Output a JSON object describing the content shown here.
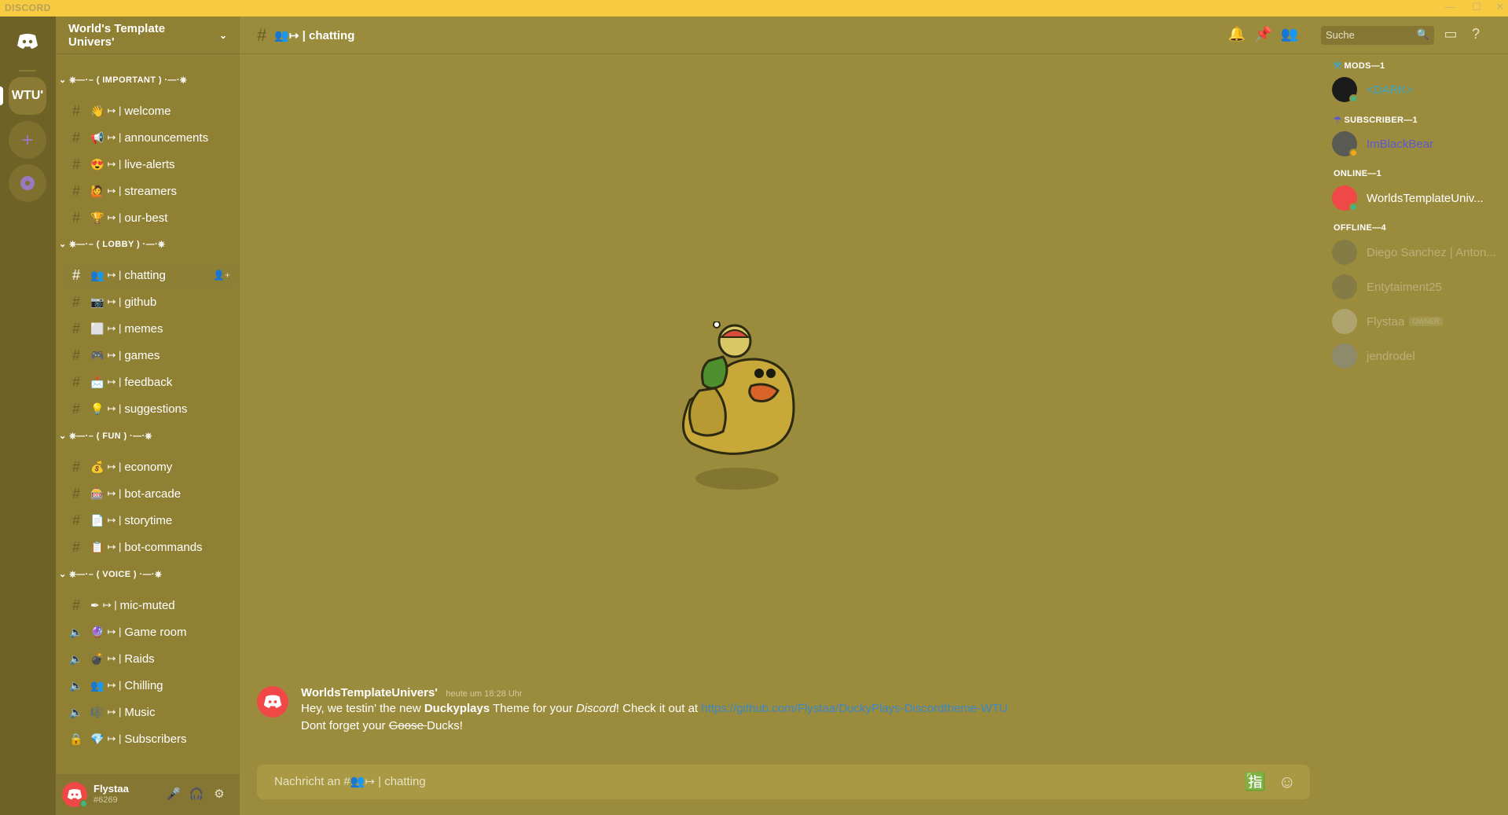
{
  "window": {
    "brand": "DISCORD",
    "minimize": "—",
    "maximize": "☐",
    "close": "✕"
  },
  "guilds": {
    "selected_acronym": "WTU'",
    "add_glyph": "+"
  },
  "server": {
    "name": "World's Template Univers'",
    "chevron": "⌄"
  },
  "categories": {
    "important": "⌄ ⎈—·– ( IMPORTANT ) ·—·⎈",
    "lobby": "⌄ ⎈—·– ( LOBBY ) ·—·⎈",
    "fun": "⌄ ⎈—·– ( FUN ) ·—·⎈",
    "voice": "⌄ ⎈—·– ( VOICE ) ·—·⎈"
  },
  "channels": [
    {
      "name": "welcome",
      "emoji": "👋",
      "type": "text"
    },
    {
      "name": "announcements",
      "emoji": "📢",
      "type": "text"
    },
    {
      "name": "live-alerts",
      "emoji": "😍",
      "type": "text"
    },
    {
      "name": "streamers",
      "emoji": "🙋",
      "type": "text"
    },
    {
      "name": "our-best",
      "emoji": "🏆",
      "type": "text"
    },
    {
      "name": "chatting",
      "emoji": "👥",
      "type": "text",
      "active": true
    },
    {
      "name": "github",
      "emoji": "📷",
      "type": "text"
    },
    {
      "name": "memes",
      "emoji": "⬜",
      "type": "text"
    },
    {
      "name": "games",
      "emoji": "🎮",
      "type": "text"
    },
    {
      "name": "feedback",
      "emoji": "📩",
      "type": "text"
    },
    {
      "name": "suggestions",
      "emoji": "💡",
      "type": "text"
    },
    {
      "name": "economy",
      "emoji": "💰",
      "type": "text"
    },
    {
      "name": "bot-arcade",
      "emoji": "🎰",
      "type": "text"
    },
    {
      "name": "storytime",
      "emoji": "📄",
      "type": "text"
    },
    {
      "name": "bot-commands",
      "emoji": "📋",
      "type": "text"
    },
    {
      "name": "mic-muted",
      "emoji": "✒",
      "type": "text"
    },
    {
      "name": "Game room",
      "emoji": "🔮",
      "type": "voice"
    },
    {
      "name": "Raids",
      "emoji": "💣",
      "type": "voice"
    },
    {
      "name": "Chilling",
      "emoji": "👥",
      "type": "voice"
    },
    {
      "name": "Music",
      "emoji": "🎼",
      "type": "voice"
    },
    {
      "name": "Subscribers",
      "emoji": "💎",
      "type": "locked"
    }
  ],
  "channel_prefix": "↦ |",
  "user": {
    "name": "Flystaa",
    "tag": "#6269"
  },
  "header": {
    "channel_title": "👥↦ | chatting",
    "search_placeholder": "Suche"
  },
  "message": {
    "author": "WorldsTemplateUnivers'",
    "timestamp": "heute um 18:28 Uhr",
    "line1_a": "Hey, we testin' the new ",
    "line1_bold": "Duckyplays",
    "line1_b": " Theme for your ",
    "line1_italic": "Discord",
    "line1_c": "! Check it out at ",
    "link": "https://github.com/Flystaa/DuckyPlays-Discordtheme-WTU",
    "line2_a": "Dont forget your ",
    "line2_strike": "Goose ",
    "line2_b": "Ducks!"
  },
  "composer": {
    "placeholder": "Nachricht an #👥↦ | chatting"
  },
  "members": {
    "mods_header": "MODS—1",
    "subscriber_header": "SUBSCRIBER—1",
    "online_header": "ONLINE—1",
    "offline_header": "OFFLINE—4",
    "mods": [
      {
        "name": "<DARK>",
        "color": "#3aa7c9"
      }
    ],
    "subscribers": [
      {
        "name": "ImBlackBear",
        "color": "#5d57d1"
      }
    ],
    "online": [
      {
        "name": "WorldsTemplateUniv...",
        "color": "#ffffff"
      }
    ],
    "offline": [
      {
        "name": "Diego Sanchez | Anton..."
      },
      {
        "name": "Entytaiment25"
      },
      {
        "name": "Flystaa",
        "badge": "OWNER"
      },
      {
        "name": "jendrodel"
      }
    ]
  },
  "colors": {
    "accent": "#f6cb42",
    "link": "#3b87c8",
    "danger": "#f04747",
    "online": "#43b581"
  }
}
